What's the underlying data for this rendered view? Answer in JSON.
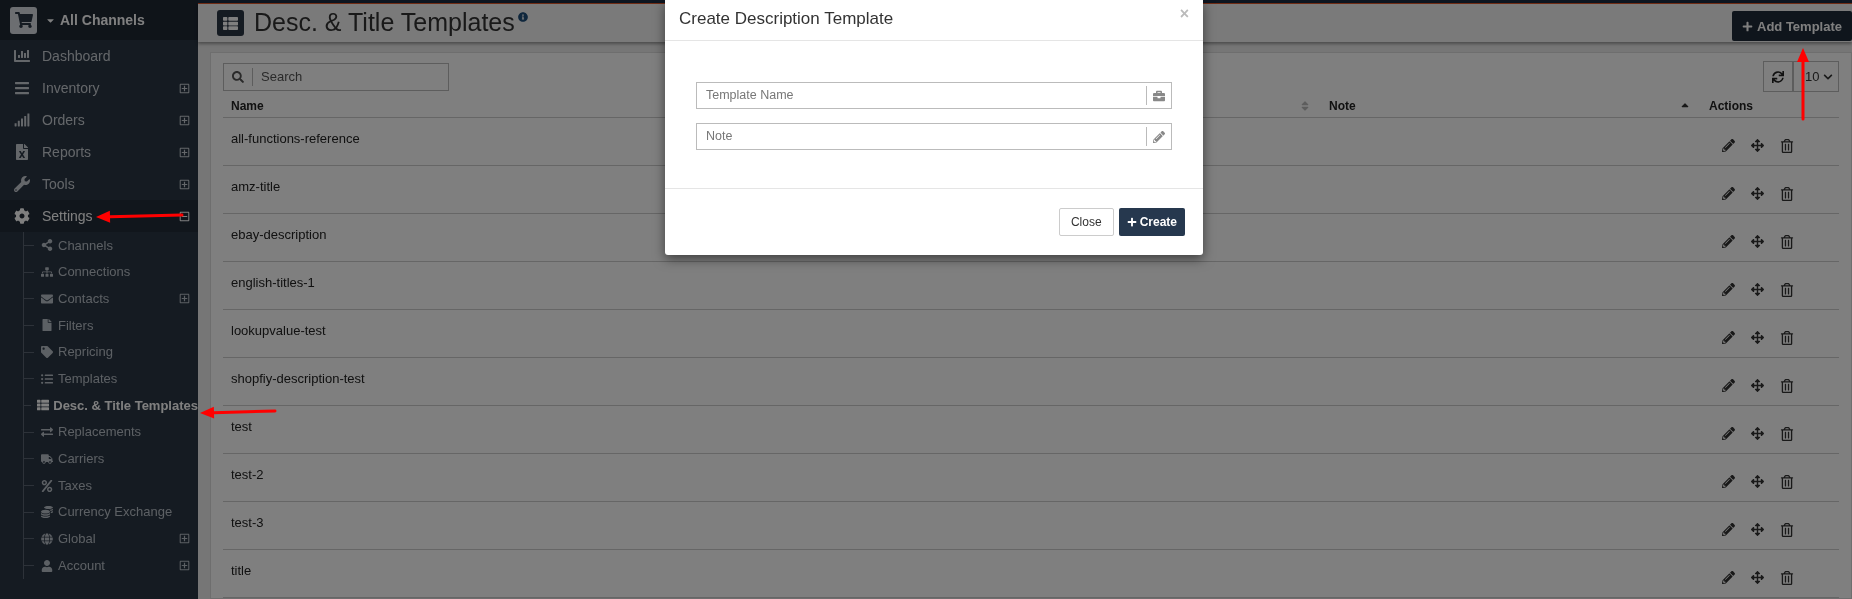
{
  "sidebar": {
    "brand": "All Channels",
    "items": [
      {
        "kind": "link",
        "label": "Dashboard",
        "selected": false
      },
      {
        "kind": "group",
        "label": "Inventory",
        "expanded": false,
        "selected": false
      },
      {
        "kind": "group",
        "label": "Orders",
        "expanded": false,
        "selected": false
      },
      {
        "kind": "group",
        "label": "Reports",
        "expanded": false,
        "selected": false
      },
      {
        "kind": "group",
        "label": "Tools",
        "expanded": false,
        "selected": false
      },
      {
        "kind": "group",
        "label": "Settings",
        "expanded": true,
        "selected": true,
        "children": [
          {
            "kind": "link",
            "label": "Channels",
            "selected": false
          },
          {
            "kind": "link",
            "label": "Connections",
            "selected": false
          },
          {
            "kind": "group",
            "label": "Contacts",
            "selected": false,
            "expanded": false
          },
          {
            "kind": "link",
            "label": "Filters",
            "selected": false
          },
          {
            "kind": "link",
            "label": "Repricing",
            "selected": false
          },
          {
            "kind": "link",
            "label": "Templates",
            "selected": false
          },
          {
            "kind": "link",
            "label": "Desc. & Title Templates",
            "selected": true
          },
          {
            "kind": "link",
            "label": "Replacements",
            "selected": false
          },
          {
            "kind": "link",
            "label": "Carriers",
            "selected": false
          },
          {
            "kind": "link",
            "label": "Taxes",
            "selected": false
          },
          {
            "kind": "link",
            "label": "Currency Exchange",
            "selected": false
          },
          {
            "kind": "group",
            "label": "Global",
            "selected": false,
            "expanded": false
          },
          {
            "kind": "group",
            "label": "Account",
            "selected": false,
            "expanded": false
          }
        ]
      }
    ]
  },
  "page": {
    "title": "Desc. & Title Templates",
    "add_button": "Add Template",
    "search": {
      "placeholder": "Search"
    },
    "page_size": "10"
  },
  "table": {
    "columns": [
      {
        "label": "Name",
        "sorted": false
      },
      {
        "label": "Note",
        "sorted": true
      },
      {
        "label": "Actions"
      }
    ],
    "rows": [
      {
        "name": "all-functions-reference"
      },
      {
        "name": "amz-title"
      },
      {
        "name": "ebay-description"
      },
      {
        "name": "english-titles-1"
      },
      {
        "name": "lookupvalue-test"
      },
      {
        "name": "shopfiy-description-test"
      },
      {
        "name": "test"
      },
      {
        "name": "test-2"
      },
      {
        "name": "test-3"
      },
      {
        "name": "title"
      }
    ]
  },
  "modal": {
    "title": "Create Description Template",
    "close": "×",
    "fields": [
      {
        "placeholder": "Template Name"
      },
      {
        "placeholder": "Note"
      }
    ],
    "buttons": [
      {
        "label": "Close",
        "kind": "default"
      },
      {
        "label": "Create",
        "kind": "primary"
      }
    ]
  }
}
